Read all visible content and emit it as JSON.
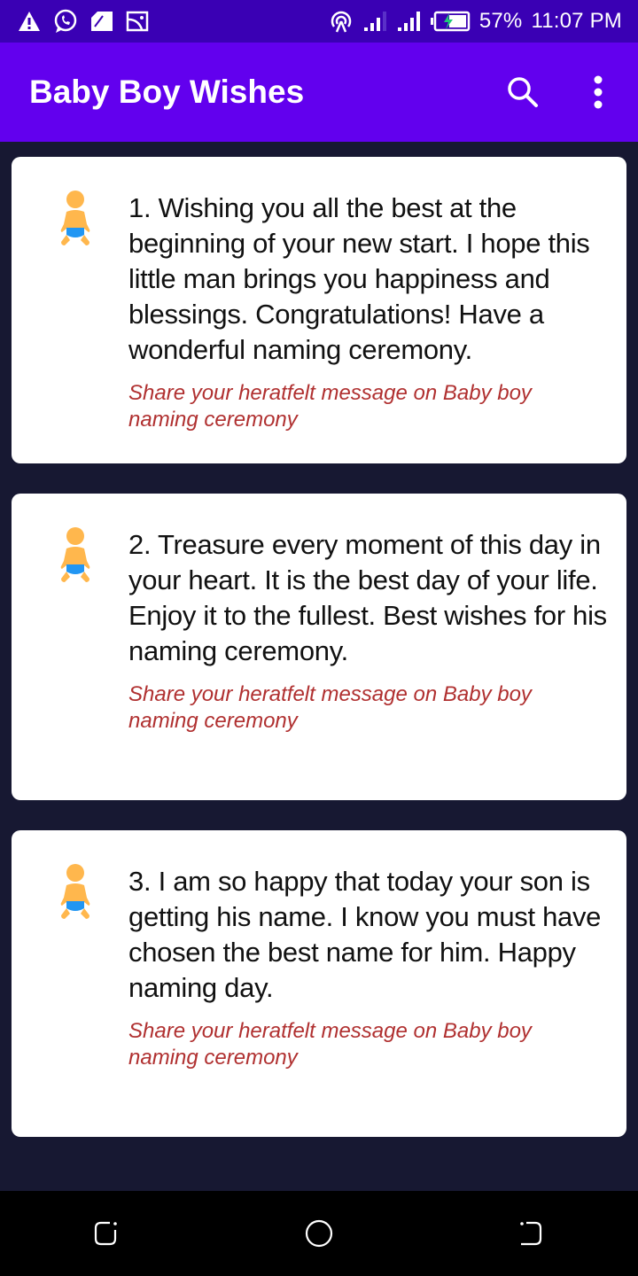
{
  "status_bar": {
    "left_icons": [
      "warning-icon",
      "whatsapp-icon",
      "sim-icon",
      "image-icon"
    ],
    "right_icons": [
      "hotspot-icon",
      "signal-1-icon",
      "signal-2-icon",
      "battery-charging-icon"
    ],
    "battery": "57%",
    "time": "11:07 PM"
  },
  "app_bar": {
    "title": "Baby Boy Wishes",
    "actions": [
      "search-icon",
      "more-vert-icon"
    ],
    "color": "#6200ee"
  },
  "wishes": [
    {
      "text": "1. Wishing you all the best at the beginning of your new start. I hope this little man brings you happiness and blessings. Congratulations! Have a wonderful naming ceremony.",
      "subtitle": "Share your heratfelt message on Baby boy naming ceremony",
      "icon": "baby-icon"
    },
    {
      "text": "2. Treasure every moment of this day in your heart. It is the best day of your life. Enjoy it to the fullest. Best wishes for his naming ceremony.",
      "subtitle": "Share your heratfelt message on Baby boy naming ceremony",
      "icon": "baby-icon"
    },
    {
      "text": "3. I am so happy that today your son is getting his name. I know you must have chosen the best name for him. Happy naming day.",
      "subtitle": "Share your heratfelt message on Baby boy naming ceremony",
      "icon": "baby-icon"
    }
  ],
  "nav_bar": {
    "buttons": [
      "recents-icon",
      "home-icon",
      "back-icon"
    ]
  },
  "colors": {
    "accent": "#6200ee",
    "status_bar": "#3a00b4",
    "subtitle": "#b03030",
    "background": "#171832"
  }
}
